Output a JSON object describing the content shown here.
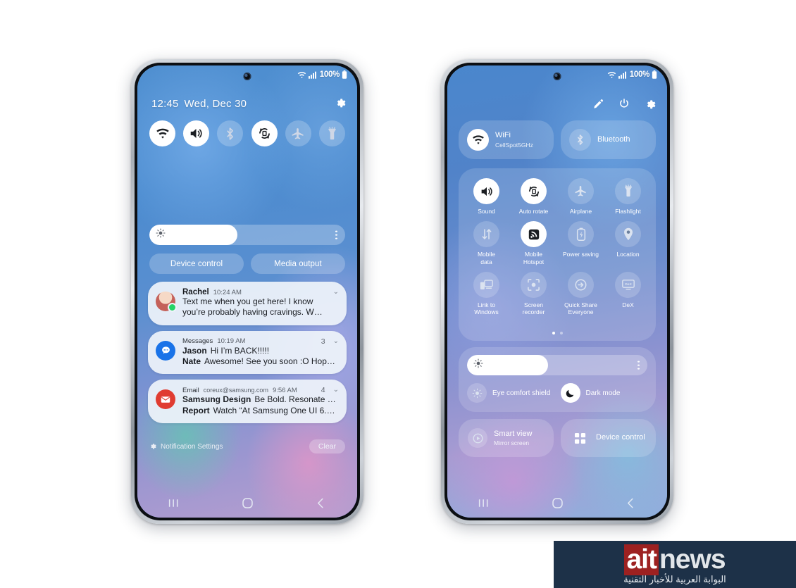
{
  "left_phone": {
    "status_bar": {
      "battery_pct": "100%",
      "wifi_icon": "wifi-icon",
      "signal_icon": "signal-bars-icon",
      "battery_icon": "battery-full-icon"
    },
    "clock": "12:45",
    "date": "Wed, Dec 30",
    "settings_icon": "gear-icon",
    "quick_toggles": [
      {
        "name": "wifi-toggle",
        "icon": "wifi-icon",
        "state": "on"
      },
      {
        "name": "sound-toggle",
        "icon": "speaker-icon",
        "state": "on"
      },
      {
        "name": "bluetooth-toggle",
        "icon": "bluetooth-icon",
        "state": "off"
      },
      {
        "name": "auto-rotate-toggle",
        "icon": "auto-rotate-icon",
        "state": "on"
      },
      {
        "name": "airplane-toggle",
        "icon": "airplane-icon",
        "state": "off"
      },
      {
        "name": "flashlight-toggle",
        "icon": "flashlight-icon",
        "state": "off"
      }
    ],
    "brightness": {
      "icon": "brightness-sun-icon",
      "value_pct": 45,
      "more_icon": "more-vertical-icon"
    },
    "pills": [
      {
        "label": "Device control"
      },
      {
        "label": "Media output"
      }
    ],
    "notifications": [
      {
        "app": "",
        "sender": "Rachel",
        "time": "10:24 AM",
        "count": "",
        "avatar": "contact-photo-avatar",
        "badge": "whatsapp-badge-icon",
        "lines": [
          {
            "sender": "",
            "text": "Text me when you get here! I know"
          },
          {
            "sender": "",
            "text": "you’re probably having cravings. W…"
          }
        ]
      },
      {
        "app": "Messages",
        "sender": "",
        "time": "10:19 AM",
        "count": "3",
        "avatar": "messages-app-icon",
        "badge": "",
        "lines": [
          {
            "sender": "Jason",
            "text": "Hi I’m BACK!!!!!"
          },
          {
            "sender": "Nate",
            "text": "Awesome! See you soon :O Hop…"
          }
        ]
      },
      {
        "app": "Email",
        "email": "coreux@samsung.com",
        "sender": "",
        "time": "9:56 AM",
        "count": "4",
        "avatar": "email-app-icon",
        "badge": "",
        "lines": [
          {
            "sender": "Samsung Design",
            "text": "Be Bold. Resonate w…"
          },
          {
            "sender": "Report",
            "text": "Watch “At Samsung One UI 6.0…"
          }
        ]
      }
    ],
    "footer": {
      "settings_icon": "gear-icon",
      "settings_label": "Notification Settings",
      "clear_label": "Clear"
    },
    "nav_bar": [
      {
        "name": "recents-button",
        "glyph": "|||"
      },
      {
        "name": "home-button",
        "glyph": "O"
      },
      {
        "name": "back-button",
        "glyph": "<"
      }
    ]
  },
  "right_phone": {
    "status_bar": {
      "battery_pct": "100%",
      "wifi_icon": "wifi-icon",
      "signal_icon": "signal-bars-icon",
      "battery_icon": "battery-full-icon"
    },
    "header_icons": [
      {
        "name": "edit-pencil-icon"
      },
      {
        "name": "power-icon"
      },
      {
        "name": "gear-icon"
      }
    ],
    "connectivity": [
      {
        "name": "wifi-card",
        "icon": "wifi-icon",
        "title": "WiFi",
        "subtitle": "CellSpot5GHz",
        "state": "on"
      },
      {
        "name": "bluetooth-card",
        "icon": "bluetooth-icon",
        "title": "Bluetooth",
        "subtitle": "",
        "state": "off"
      }
    ],
    "toggle_grid": [
      {
        "name": "sound-toggle",
        "icon": "speaker-icon",
        "label": "Sound",
        "state": "on"
      },
      {
        "name": "auto-rotate-toggle",
        "icon": "auto-rotate-icon",
        "label": "Auto rotate",
        "state": "on"
      },
      {
        "name": "airplane-toggle",
        "icon": "airplane-icon",
        "label": "Airplane",
        "state": "off"
      },
      {
        "name": "flashlight-toggle",
        "icon": "flashlight-icon",
        "label": "Flashlight",
        "state": "off"
      },
      {
        "name": "mobile-data-toggle",
        "icon": "data-arrows-icon",
        "label": "Mobile\ndata",
        "state": "off"
      },
      {
        "name": "mobile-hotspot-toggle",
        "icon": "hotspot-icon",
        "label": "Mobile\nHotspot",
        "state": "on"
      },
      {
        "name": "power-saving-toggle",
        "icon": "battery-saver-icon",
        "label": "Power saving",
        "state": "off"
      },
      {
        "name": "location-toggle",
        "icon": "location-pin-icon",
        "label": "Location",
        "state": "off"
      },
      {
        "name": "link-to-windows-toggle",
        "icon": "link-to-windows-icon",
        "label": "Link to\nWindows",
        "state": "off"
      },
      {
        "name": "screen-recorder-toggle",
        "icon": "screen-recorder-icon",
        "label": "Screen\nrecorder",
        "state": "off"
      },
      {
        "name": "quick-share-toggle",
        "icon": "quick-share-icon",
        "label": "Quick Share\nEveryone",
        "state": "off"
      },
      {
        "name": "dex-toggle",
        "icon": "dex-icon",
        "label": "DeX",
        "state": "off"
      }
    ],
    "page_dots": {
      "total": 2,
      "active": 1
    },
    "brightness": {
      "icon": "brightness-sun-icon",
      "value_pct": 45,
      "more_icon": "more-vertical-icon"
    },
    "display_modes": [
      {
        "name": "eye-comfort-shield-toggle",
        "icon": "eye-comfort-icon",
        "label": "Eye comfort shield",
        "state": "off"
      },
      {
        "name": "dark-mode-toggle",
        "icon": "moon-icon",
        "label": "Dark mode",
        "state": "on"
      }
    ],
    "bottom_cards": [
      {
        "name": "smart-view-card",
        "icon": "smart-view-icon",
        "title": "Smart view",
        "subtitle": "Mirror screen"
      },
      {
        "name": "device-control-card",
        "icon": "device-control-icon",
        "title": "Device control",
        "subtitle": ""
      }
    ],
    "nav_bar": [
      {
        "name": "recents-button",
        "glyph": "|||"
      },
      {
        "name": "home-button",
        "glyph": "O"
      },
      {
        "name": "back-button",
        "glyph": "<"
      }
    ]
  },
  "watermark": {
    "brand_red": "ait",
    "brand_white": "news",
    "arabic": "البوابة العربية للأخبار التقنية",
    "bg_color": "#1d3148",
    "accent_color": "#9d2121"
  }
}
